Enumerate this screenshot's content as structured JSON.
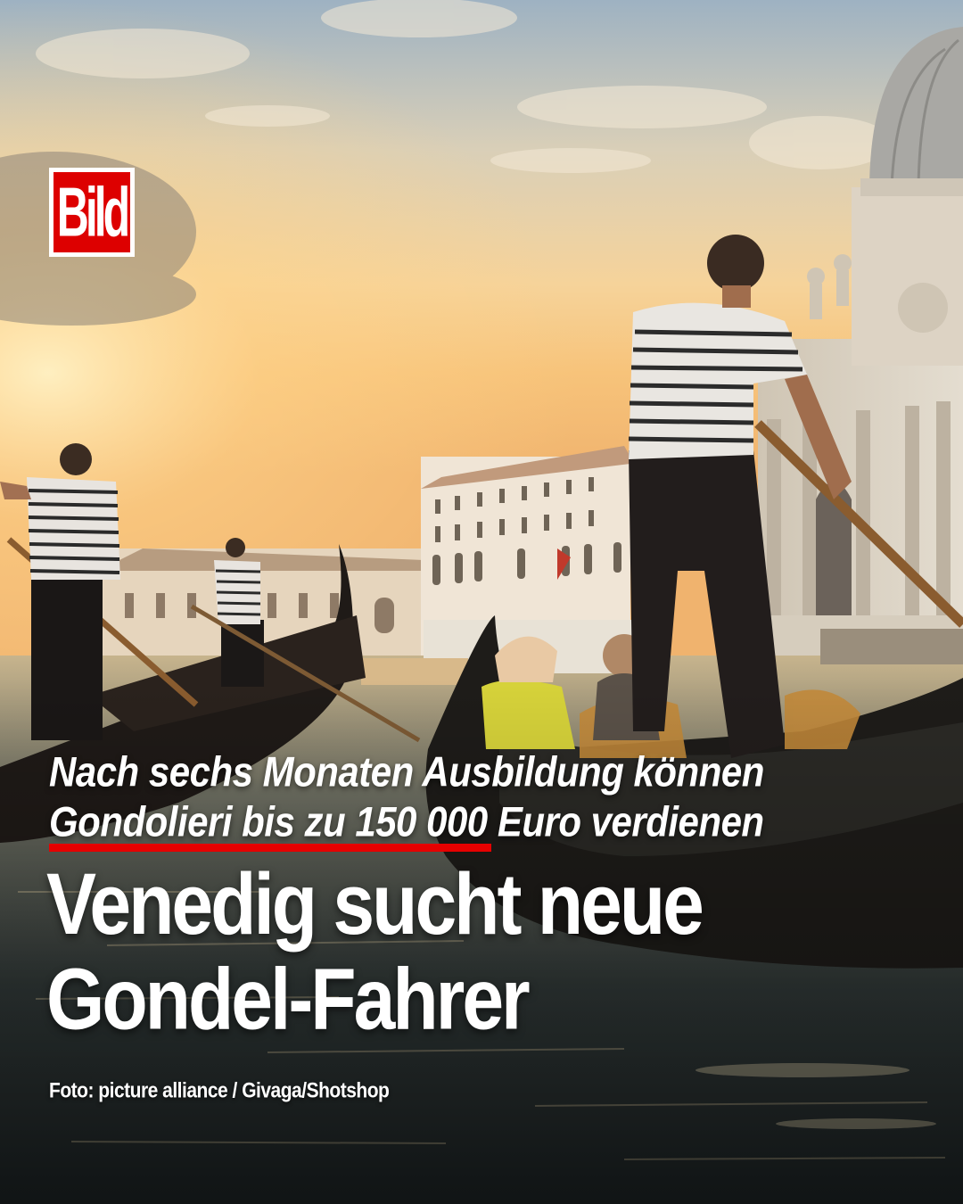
{
  "brand": {
    "logo_text": "Bild",
    "logo_red": "#dd0000"
  },
  "post": {
    "kicker_lines": [
      "Nach sechs Monaten Ausbildung können",
      "Gondolieri bis zu 150 000 Euro verdienen"
    ],
    "headline_lines": [
      "Venedig sucht neue",
      "Gondel-Fahrer"
    ],
    "photo_credit": "Foto: picture alliance / Givaga/Shotshop",
    "accent_color": "#e60000"
  }
}
